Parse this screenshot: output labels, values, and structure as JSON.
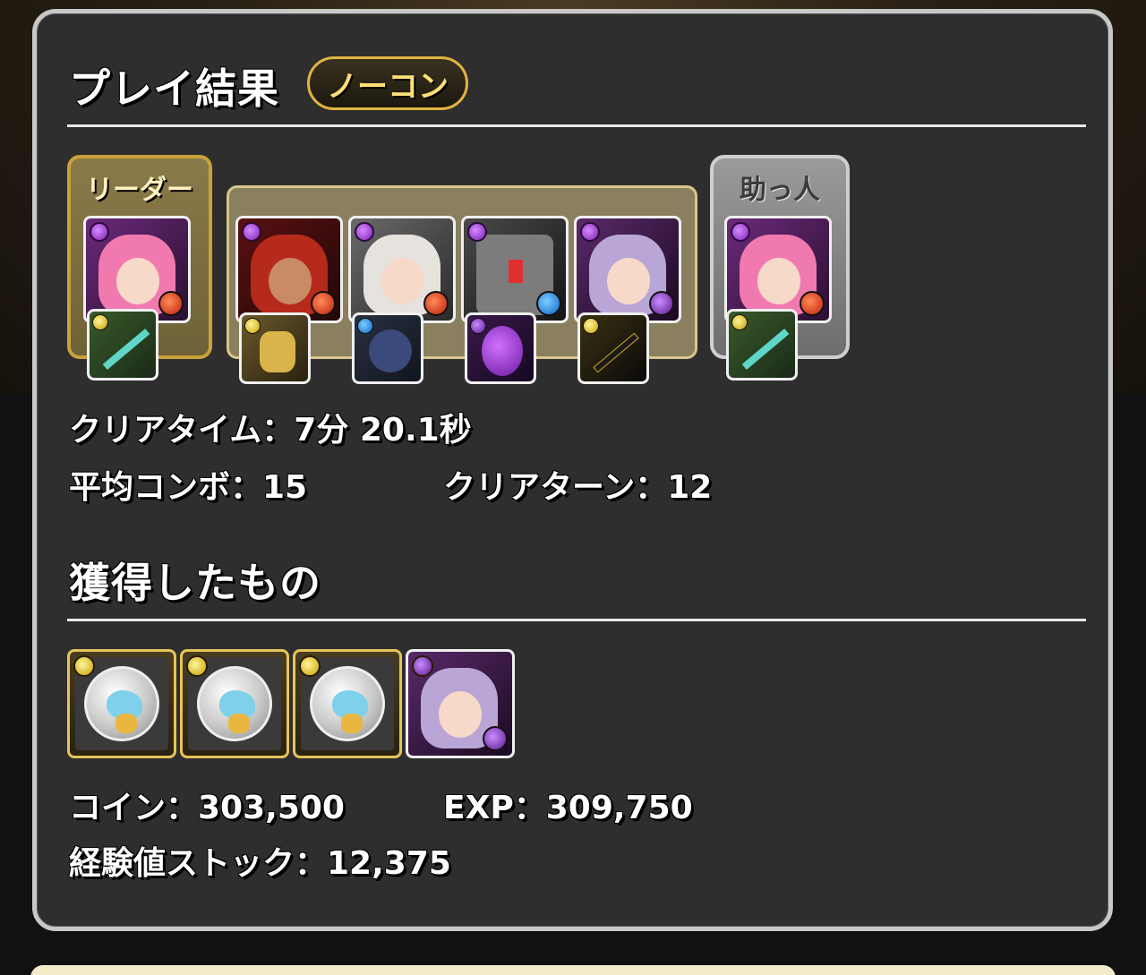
{
  "result": {
    "title": "プレイ結果",
    "badge": "ノーコン"
  },
  "team": {
    "leader_label": "リーダー",
    "helper_label": "助っ人",
    "leader": {
      "main_attr": "dark",
      "sub_attr": "fire",
      "assist_attr": "light"
    },
    "members": [
      {
        "main_attr": "dark",
        "sub_attr": "fire",
        "assist_attr": "light"
      },
      {
        "main_attr": "dark",
        "sub_attr": "fire",
        "assist_attr": "water"
      },
      {
        "main_attr": "dark",
        "sub_attr": "water",
        "assist_attr": "dark"
      },
      {
        "main_attr": "dark",
        "sub_attr": "dark",
        "assist_attr": "light"
      }
    ],
    "helper": {
      "main_attr": "dark",
      "sub_attr": "fire",
      "assist_attr": "light"
    }
  },
  "stats": {
    "clear_time": "クリアタイム：7分 20.1秒",
    "avg_combo": "平均コンボ：15",
    "clear_turn": "クリアターン：12"
  },
  "obtained": {
    "title": "獲得したもの",
    "drops": [
      {
        "type": "coin-monster",
        "attr": "light"
      },
      {
        "type": "coin-monster",
        "attr": "light"
      },
      {
        "type": "coin-monster",
        "attr": "light"
      },
      {
        "type": "card",
        "attr": "dark"
      }
    ],
    "coin": "コイン：303,500",
    "exp": "EXP：309,750",
    "exp_stock": "経験値ストック：12,375"
  },
  "colors": {
    "panel_bg": "#2e2e2e",
    "panel_border": "#c8c8c8",
    "leader_gold": "#c9a23a",
    "badge_gold": "#e3b342"
  }
}
